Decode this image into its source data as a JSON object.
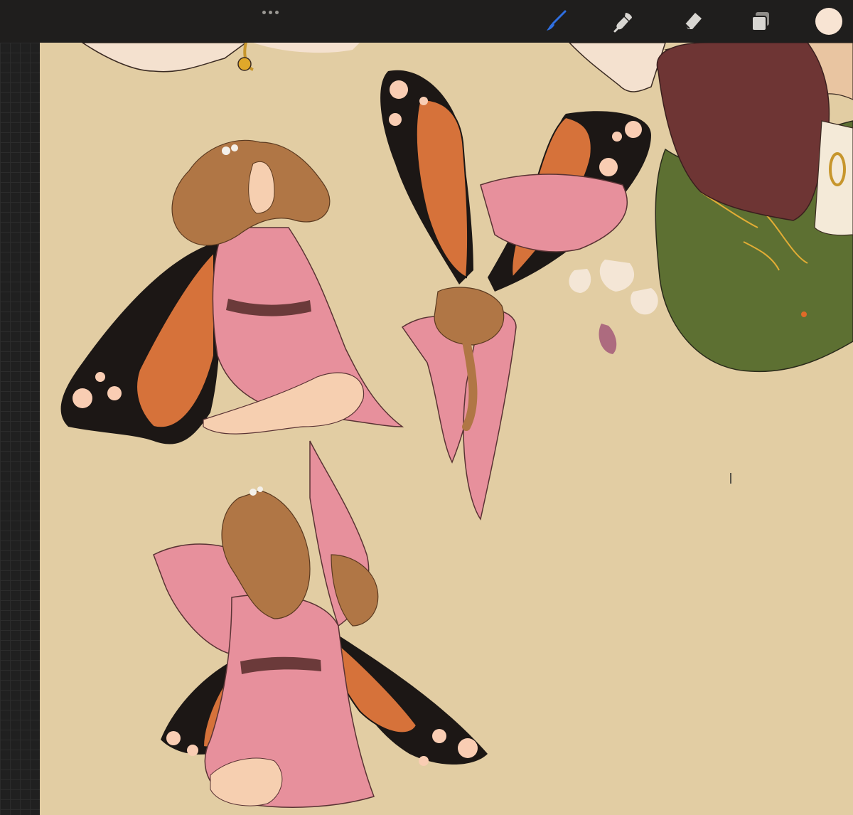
{
  "app": "Procreate",
  "toolbar": {
    "more_icon": "more-dots-icon",
    "tools": [
      {
        "name": "brush",
        "icon": "brush-icon",
        "active": true,
        "color": "#2f6fe0"
      },
      {
        "name": "smudge",
        "icon": "smudge-icon",
        "active": false
      },
      {
        "name": "eraser",
        "icon": "eraser-icon",
        "active": false
      },
      {
        "name": "layers",
        "icon": "layers-icon",
        "active": false
      }
    ],
    "current_color": "#f8e4d3"
  },
  "colors": {
    "canvas_background": "#e2cda3",
    "robe_pink": "#e7909c",
    "wing_orange": "#d6723a",
    "wing_black": "#1c1715",
    "hair_brown": "#b07645",
    "dress_green": "#5d7032",
    "hair_dark": "#6e3534",
    "spot_peach": "#f9cdb3"
  }
}
